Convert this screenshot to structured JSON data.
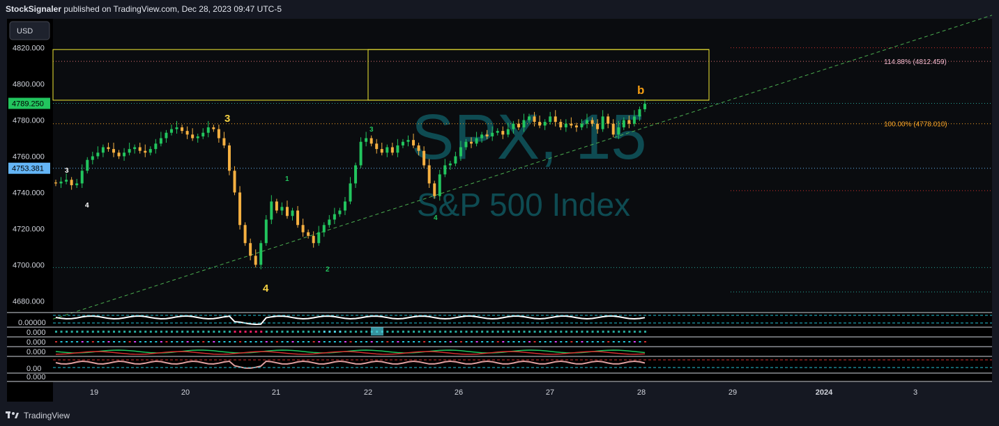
{
  "header": {
    "publisher": "StockSignaler",
    "published_text": "published on TradingView.com, Dec 28, 2023 09:47 UTC-5"
  },
  "footer": {
    "brand": "TradingView"
  },
  "currency_button": "USD",
  "watermark": {
    "symbol": "SPX, 15",
    "name": "S&P 500 Index"
  },
  "colors": {
    "background": "#151822",
    "pane": "#000000",
    "up_candle": "#22c55e",
    "down_candle": "#f5b041",
    "trendline": "#4caf50",
    "box": "#f2ea33",
    "fib_114": "#e57373",
    "fib_100": "#ffa726",
    "hline_teal": "#26a69a",
    "hline_red": "#d32f2f",
    "last_price": "#22c55e",
    "marker_price": "#64b5f6"
  },
  "price_axis_labels": [
    "4820.000",
    "4800.000",
    "4780.000",
    "4760.000",
    "4740.000",
    "4720.000",
    "4700.000",
    "4680.000"
  ],
  "price_tags": {
    "last": "4789.250",
    "marker": "4753.381"
  },
  "time_axis_labels": [
    "19",
    "20",
    "21",
    "22",
    "26",
    "27",
    "28",
    "29",
    "2024",
    "3"
  ],
  "fib_labels": {
    "f114": "114.88% (4812.459)",
    "f100": "100.00% (4778.010)"
  },
  "wave_labels": [
    {
      "text": "3",
      "color": "#ffffff"
    },
    {
      "text": "4",
      "color": "#ffffff"
    },
    {
      "text": "3",
      "color": "#f5d142"
    },
    {
      "text": "4",
      "color": "#f5d142"
    },
    {
      "text": "1",
      "color": "#22c55e"
    },
    {
      "text": "2",
      "color": "#22c55e"
    },
    {
      "text": "3",
      "color": "#22c55e"
    },
    {
      "text": "4",
      "color": "#22c55e"
    },
    {
      "text": "b",
      "color": "#f39c12"
    }
  ],
  "indicator_axis_labels": [
    "0.00000",
    "0.000",
    "0.000",
    "0.000",
    "0.00",
    "0.000"
  ],
  "chart_data": {
    "type": "candlestick",
    "symbol": "SPX",
    "timeframe": "15",
    "ylim": [
      4674,
      4836
    ],
    "last_price": 4789.25,
    "horizontal_levels": {
      "fib_114_88": 4812.459,
      "fib_100": 4778.01,
      "marker_level": 4753.381,
      "red_levels": [
        4820,
        4741
      ],
      "teal_levels": [
        4789.25,
        4698.5,
        4685
      ]
    },
    "box": {
      "top": 4819,
      "bottom": 4791
    },
    "trendline": {
      "start": 4670,
      "end": 4838
    },
    "close_series": [
      4745,
      4746,
      4747,
      4744,
      4745,
      4752,
      4758,
      4760,
      4762,
      4765,
      4764,
      4762,
      4760,
      4762,
      4764,
      4765,
      4763,
      4762,
      4764,
      4767,
      4770,
      4773,
      4775,
      4776,
      4774,
      4772,
      4770,
      4771,
      4773,
      4776,
      4775,
      4770,
      4766,
      4752,
      4740,
      4722,
      4712,
      4705,
      4700,
      4712,
      4725,
      4735,
      4730,
      4732,
      4727,
      4730,
      4722,
      4718,
      4716,
      4712,
      4718,
      4722,
      4725,
      4728,
      4730,
      4735,
      4745,
      4755,
      4768,
      4770,
      4767,
      4764,
      4762,
      4765,
      4762,
      4766,
      4768,
      4769,
      4766,
      4763,
      4755,
      4745,
      4738,
      4750,
      4755,
      4756,
      4760,
      4765,
      4768,
      4767,
      4770,
      4772,
      4771,
      4773,
      4774,
      4772,
      4775,
      4778,
      4776,
      4780,
      4782,
      4779,
      4777,
      4779,
      4782,
      4779,
      4776,
      4778,
      4777,
      4776,
      4778,
      4780,
      4778,
      4775,
      4782,
      4778,
      4772,
      4776,
      4780,
      4778,
      4782,
      4786,
      4789
    ]
  }
}
